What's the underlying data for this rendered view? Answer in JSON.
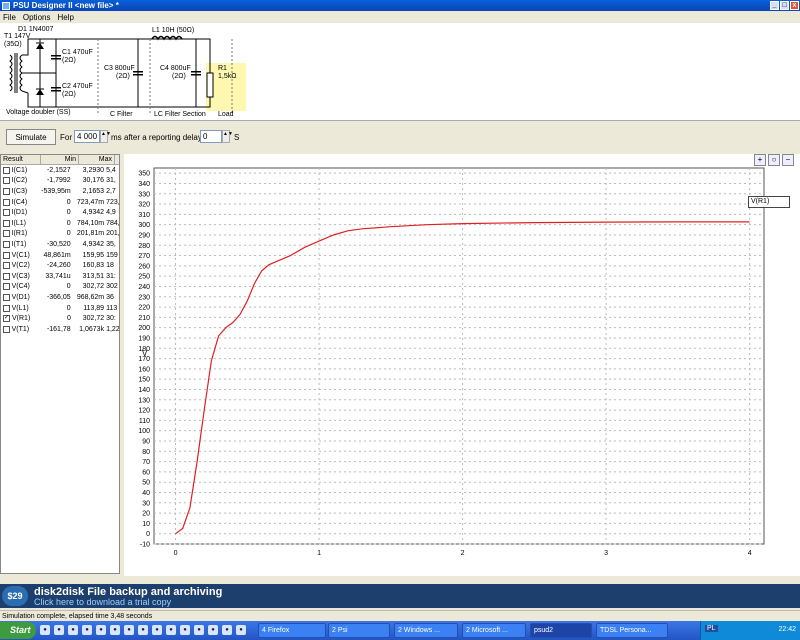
{
  "window": {
    "title": "PSU Designer II  <new file> *",
    "buttons": [
      "_",
      "□",
      "x"
    ]
  },
  "menu": [
    "File",
    "Options",
    "Help"
  ],
  "schematic": {
    "transformer": [
      "T1 147V",
      "(35Ω)"
    ],
    "diode": "D1 1N4007",
    "c1": [
      "C1 470uF",
      "(2Ω)"
    ],
    "c2": [
      "C2 470uF",
      "(2Ω)"
    ],
    "section_doubler": "Voltage doubler (SS)",
    "l1": "L1 10H (50Ω)",
    "c3": [
      "C3 800uF",
      "(2Ω)"
    ],
    "c4": [
      "C4 800uF",
      "(2Ω)"
    ],
    "r1": [
      "R1",
      "1,5kΩ"
    ],
    "section_cfilter": "C Filter",
    "section_lcfilter": "LC Filter Section",
    "section_load": "Load"
  },
  "sim": {
    "button": "Simulate",
    "for_label": "For",
    "duration": "4 000",
    "ms_label": "ms",
    "delay_label": "after a reporting delay of",
    "delay": "0",
    "s_label": "S"
  },
  "results": {
    "headers": [
      "Result",
      "Min",
      "Max"
    ],
    "rows": [
      {
        "checked": false,
        "name": "I(C1)",
        "min": "-2,1527",
        "max": "3,2930",
        "extra": "5,4"
      },
      {
        "checked": false,
        "name": "I(C2)",
        "min": "-1,7992",
        "max": "30,176",
        "extra": "31,"
      },
      {
        "checked": false,
        "name": "I(C3)",
        "min": "-539,95m",
        "max": "2,1653",
        "extra": "2,7"
      },
      {
        "checked": false,
        "name": "I(C4)",
        "min": "0",
        "max": "723,47m",
        "extra": "723,"
      },
      {
        "checked": false,
        "name": "I(D1)",
        "min": "0",
        "max": "4,9342",
        "extra": "4,9"
      },
      {
        "checked": false,
        "name": "I(L1)",
        "min": "0",
        "max": "784,10m",
        "extra": "784,"
      },
      {
        "checked": false,
        "name": "I(R1)",
        "min": "0",
        "max": "201,81m",
        "extra": "201,"
      },
      {
        "checked": false,
        "name": "I(T1)",
        "min": "-30,520",
        "max": "4,9342",
        "extra": "35,"
      },
      {
        "checked": false,
        "name": "V(C1)",
        "min": "48,861m",
        "max": "159,95",
        "extra": "159"
      },
      {
        "checked": false,
        "name": "V(C2)",
        "min": "-24,260",
        "max": "160,83",
        "extra": "18"
      },
      {
        "checked": false,
        "name": "V(C3)",
        "min": "33,741u",
        "max": "313,51",
        "extra": "31:"
      },
      {
        "checked": false,
        "name": "V(C4)",
        "min": "0",
        "max": "302,72",
        "extra": "302"
      },
      {
        "checked": false,
        "name": "V(D1)",
        "min": "-366,05",
        "max": "968,62m",
        "extra": "36"
      },
      {
        "checked": false,
        "name": "V(L1)",
        "min": "0",
        "max": "113,89",
        "extra": "113"
      },
      {
        "checked": true,
        "name": "V(R1)",
        "min": "0",
        "max": "302,72",
        "extra": "30:"
      },
      {
        "checked": false,
        "name": "V(T1)",
        "min": "-161,78",
        "max": "1,0673k",
        "extra": "1,22"
      }
    ]
  },
  "chart_data": {
    "type": "line",
    "ylabel": "V",
    "xlim": [
      -0.15,
      4.1
    ],
    "ylim": [
      -10,
      355
    ],
    "xticks": [
      0,
      1,
      2,
      3,
      4
    ],
    "yticks": [
      -10,
      0,
      10,
      20,
      30,
      40,
      50,
      60,
      70,
      80,
      90,
      100,
      110,
      120,
      130,
      140,
      150,
      160,
      170,
      180,
      190,
      200,
      210,
      220,
      230,
      240,
      250,
      260,
      270,
      280,
      290,
      300,
      310,
      320,
      330,
      340,
      350
    ],
    "grid": true,
    "legend": "top-right",
    "series": [
      {
        "name": "V(R1)",
        "color": "#e02020",
        "x": [
          0,
          0.05,
          0.1,
          0.15,
          0.2,
          0.25,
          0.3,
          0.35,
          0.4,
          0.45,
          0.5,
          0.55,
          0.6,
          0.65,
          0.7,
          0.75,
          0.8,
          0.9,
          1.0,
          1.1,
          1.2,
          1.3,
          1.5,
          1.75,
          2.0,
          2.5,
          3.0,
          3.5,
          4.0
        ],
        "y": [
          0,
          5,
          25,
          70,
          120,
          168,
          192,
          200,
          205,
          213,
          226,
          243,
          255,
          261,
          264,
          267,
          270,
          278,
          284,
          290,
          294,
          296,
          298,
          300,
          301,
          302,
          302.5,
          302.7,
          302.7
        ]
      }
    ]
  },
  "chart_ui": {
    "zoom_buttons": [
      "zoom-in",
      "zoom-fit",
      "zoom-out"
    ]
  },
  "ad": {
    "logo": "$29",
    "title": "disk2disk File backup and archiving",
    "subtitle": "Click here to download a trial copy"
  },
  "status": "Simulation complete, elapsed time 3,48 seconds",
  "taskbar": {
    "start": "Start",
    "tasks": [
      "4 Firefox",
      "2 Psi",
      "2 Windows ...",
      "2 Microsoft ...",
      "psud2",
      "TDSL Persona..."
    ],
    "tray": "PL",
    "clock": "22:42"
  }
}
